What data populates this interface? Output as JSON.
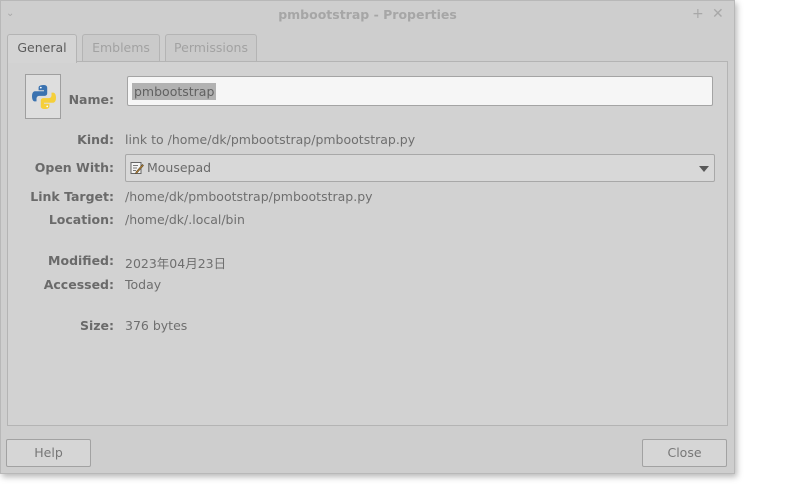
{
  "window": {
    "title": "pmbootstrap - Properties",
    "menu_glyph": "⌄",
    "stick_glyph": "+",
    "close_glyph": "✕"
  },
  "tabs": [
    {
      "label": "General",
      "active": true
    },
    {
      "label": "Emblems",
      "active": false
    },
    {
      "label": "Permissions",
      "active": false
    }
  ],
  "general": {
    "name_label": "Name:",
    "name_value": "pmbootstrap",
    "kind_label": "Kind:",
    "kind_value": "link to /home/dk/pmbootstrap/pmbootstrap.py",
    "open_with_label": "Open With:",
    "open_with_value": "Mousepad",
    "link_target_label": "Link Target:",
    "link_target_value": "/home/dk/pmbootstrap/pmbootstrap.py",
    "location_label": "Location:",
    "location_value": "/home/dk/.local/bin",
    "modified_label": "Modified:",
    "modified_value": "2023年04月23日",
    "accessed_label": "Accessed:",
    "accessed_value": "Today",
    "size_label": "Size:",
    "size_value": "376 bytes"
  },
  "footer": {
    "help_label": "Help",
    "close_label": "Close"
  },
  "icons": {
    "file_icon": "python-icon",
    "open_with_icon": "text-editor-icon"
  },
  "colors": {
    "window_bg": "#cecece",
    "python_blue": "#3a72b0",
    "python_yellow": "#f5cf3a"
  }
}
